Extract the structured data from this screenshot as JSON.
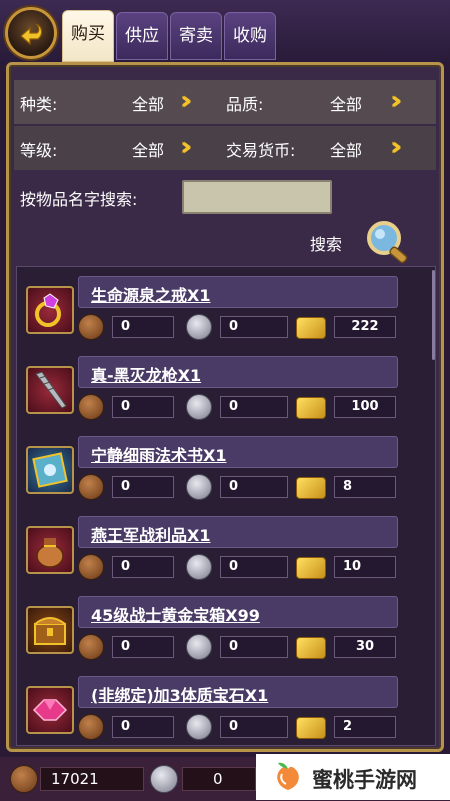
{
  "tabs": [
    {
      "label": "购买",
      "active": true
    },
    {
      "label": "供应",
      "active": false
    },
    {
      "label": "寄卖",
      "active": false
    },
    {
      "label": "收购",
      "active": false
    }
  ],
  "filters": {
    "category_label": "种类:",
    "category_value": "全部",
    "quality_label": "品质:",
    "quality_value": "全部",
    "level_label": "等级:",
    "level_value": "全部",
    "currency_label": "交易货币:",
    "currency_value": "全部",
    "name_search_label": "按物品名字搜索:",
    "name_search_value": ""
  },
  "search": {
    "label": "搜索"
  },
  "items": [
    {
      "name": "生命源泉之戒X1",
      "copper": "0",
      "silver": "0",
      "gold": "222",
      "icon": "ring-icon"
    },
    {
      "name": "真-黑灭龙枪X1",
      "copper": "0",
      "silver": "0",
      "gold": "100",
      "icon": "drill-lance-icon"
    },
    {
      "name": "宁静细雨法术书X1",
      "copper": "0",
      "silver": "0",
      "gold": "8",
      "icon": "spellbook-icon"
    },
    {
      "name": "燕王军战利品X1",
      "copper": "0",
      "silver": "0",
      "gold": "10",
      "icon": "loot-bag-icon"
    },
    {
      "name": "45级战士黄金宝箱X99",
      "copper": "0",
      "silver": "0",
      "gold": "30",
      "icon": "treasure-chest-icon"
    },
    {
      "name": "(非绑定)加3体质宝石X1",
      "copper": "0",
      "silver": "0",
      "gold": "2",
      "icon": "gem-icon"
    }
  ],
  "wallet": {
    "copper": "17021",
    "silver": "0"
  },
  "watermark": {
    "text": "蜜桃手游网"
  },
  "colors": {
    "accent_gold": "#f2c22a",
    "panel_border": "#b8944a",
    "item_box": "#4a3a66"
  }
}
